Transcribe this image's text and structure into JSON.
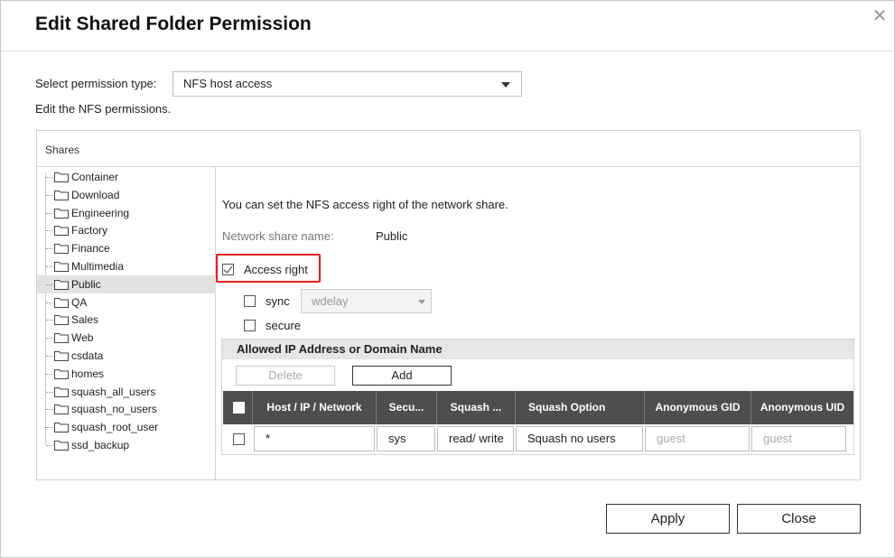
{
  "dialog": {
    "title": "Edit Shared Folder Permission",
    "close_glyph": "✕"
  },
  "permission": {
    "label": "Select permission type:",
    "selected": "NFS host access",
    "description": "Edit the NFS permissions."
  },
  "shares": {
    "header": "Shares",
    "items": [
      {
        "label": "Container"
      },
      {
        "label": "Download"
      },
      {
        "label": "Engineering"
      },
      {
        "label": "Factory"
      },
      {
        "label": "Finance"
      },
      {
        "label": "Multimedia"
      },
      {
        "label": "Public",
        "selected": true
      },
      {
        "label": "QA"
      },
      {
        "label": "Sales"
      },
      {
        "label": "Web"
      },
      {
        "label": "csdata"
      },
      {
        "label": "homes"
      },
      {
        "label": "squash_all_users"
      },
      {
        "label": "squash_no_users"
      },
      {
        "label": "squash_root_user"
      },
      {
        "label": "ssd_backup"
      }
    ]
  },
  "nfs": {
    "intro": "You can set the NFS access right of the network share.",
    "share_name_label": "Network share name:",
    "share_name_value": "Public",
    "access_right_label": "Access right",
    "access_right_checked": true,
    "sync_label": "sync",
    "sync_checked": false,
    "sync_mode": "wdelay",
    "secure_label": "secure",
    "secure_checked": false
  },
  "allowed": {
    "header": "Allowed IP Address or Domain Name",
    "delete_label": "Delete",
    "add_label": "Add",
    "columns": [
      "Host / IP / Network",
      "Secu...",
      "Squash ...",
      "Squash Option",
      "Anonymous GID",
      "Anonymous UID"
    ],
    "rows": [
      {
        "host": "*",
        "security": "sys",
        "squash": "read/ write",
        "squash_option": "Squash no users",
        "anon_gid": "guest",
        "anon_uid": "guest"
      }
    ]
  },
  "footer": {
    "apply_label": "Apply",
    "close_label": "Close"
  }
}
